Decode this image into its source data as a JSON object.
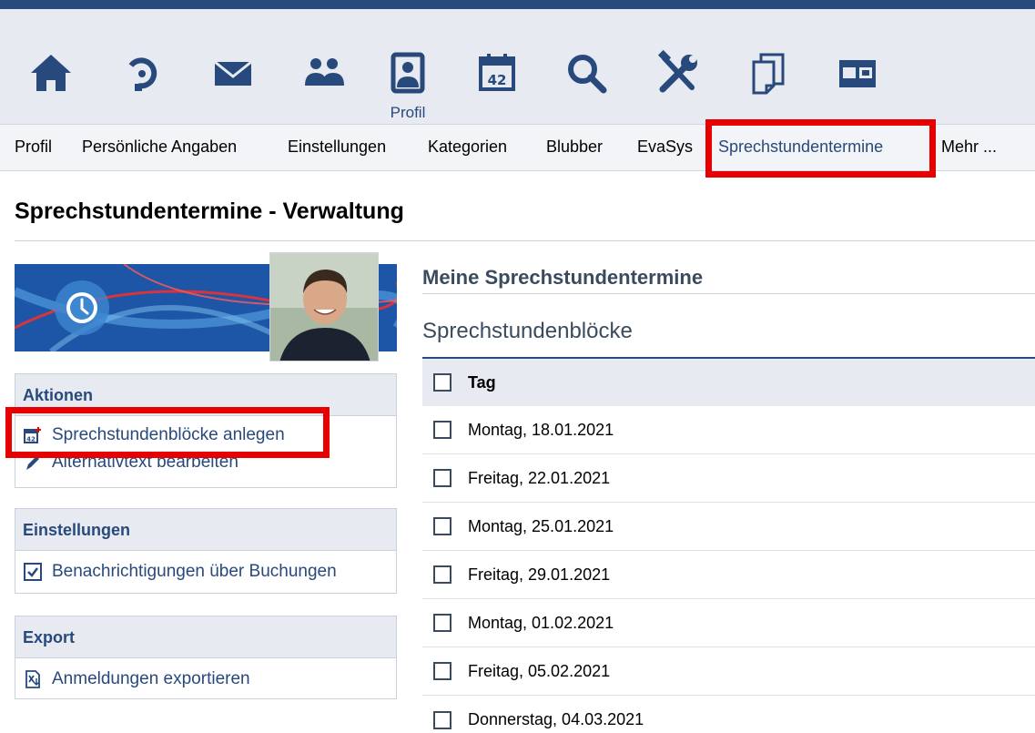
{
  "colors": {
    "brand": "#28497c",
    "highlight": "#e60000",
    "header_bg": "#e7ebf1"
  },
  "iconbar": {
    "items": [
      {
        "name": "home-icon"
      },
      {
        "name": "activity-icon"
      },
      {
        "name": "mail-icon"
      },
      {
        "name": "community-icon"
      },
      {
        "name": "profile-icon",
        "label": "Profil"
      },
      {
        "name": "calendar-icon"
      },
      {
        "name": "search-icon"
      },
      {
        "name": "tools-icon"
      },
      {
        "name": "files-icon"
      },
      {
        "name": "admin-icon"
      }
    ]
  },
  "tabs": [
    {
      "label": "Profil"
    },
    {
      "label": "Persönliche Angaben"
    },
    {
      "label": "Einstellungen"
    },
    {
      "label": "Kategorien"
    },
    {
      "label": "Blubber"
    },
    {
      "label": "EvaSys"
    },
    {
      "label": "Sprechstundentermine"
    },
    {
      "label": "Mehr ..."
    }
  ],
  "page_title": "Sprechstundentermine - Verwaltung",
  "sidebar": {
    "actions": {
      "title": "Aktionen",
      "items": [
        {
          "label": "Sprechstundenblöcke anlegen",
          "icon": "calendar-add-icon"
        },
        {
          "label": "Alternativtext bearbeiten",
          "icon": "edit-icon"
        }
      ]
    },
    "settings": {
      "title": "Einstellungen",
      "items": [
        {
          "label": "Benachrichtigungen über Buchungen",
          "icon": "checkbox-checked-icon"
        }
      ]
    },
    "export": {
      "title": "Export",
      "items": [
        {
          "label": "Anmeldungen exportieren",
          "icon": "export-file-icon"
        }
      ]
    }
  },
  "main": {
    "section_title": "Meine Sprechstundentermine",
    "subsection_title": "Sprechstundenblöcke",
    "table": {
      "header": "Tag",
      "rows": [
        "Montag, 18.01.2021",
        "Freitag, 22.01.2021",
        "Montag, 25.01.2021",
        "Freitag, 29.01.2021",
        "Montag, 01.02.2021",
        "Freitag, 05.02.2021",
        "Donnerstag, 04.03.2021"
      ]
    }
  }
}
